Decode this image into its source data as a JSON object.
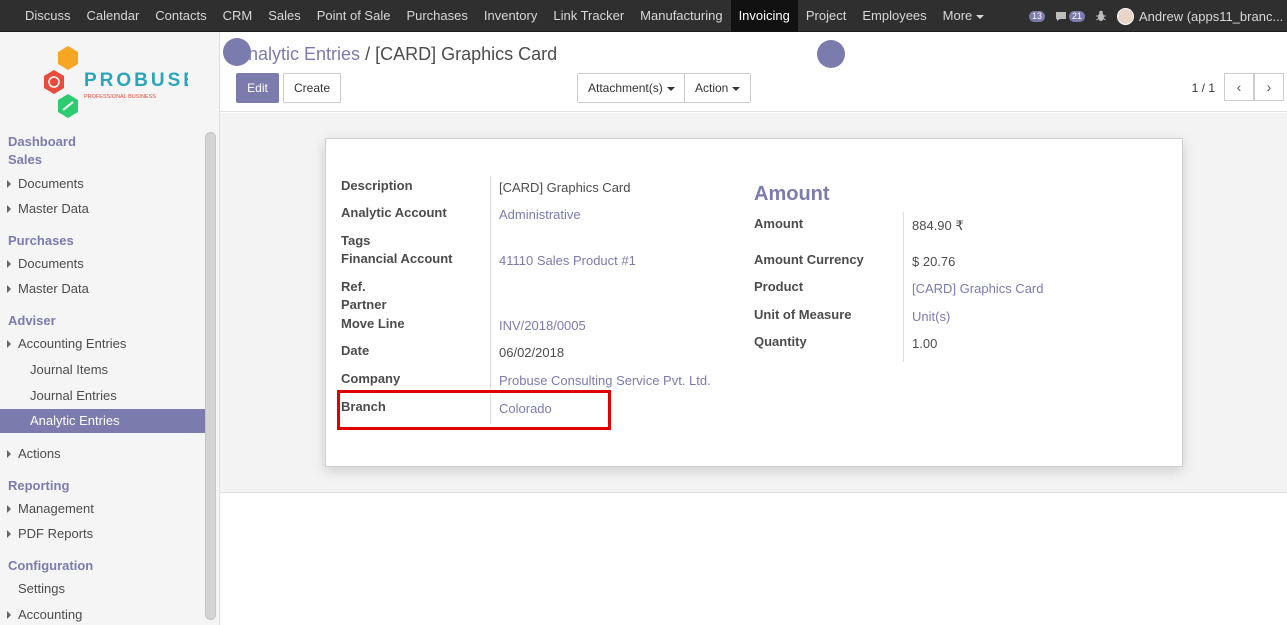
{
  "topbar": {
    "menu": [
      "Discuss",
      "Calendar",
      "Contacts",
      "CRM",
      "Sales",
      "Point of Sale",
      "Purchases",
      "Inventory",
      "Link Tracker",
      "Manufacturing",
      "Invoicing",
      "Project",
      "Employees",
      "More"
    ],
    "active": "Invoicing",
    "messages_count": "13",
    "chat_count": "21",
    "user": "Andrew (apps11_branc..."
  },
  "logo": {
    "name": "PROBUSE",
    "tagline": "PROFESSIONAL BUSINESS"
  },
  "sidebar": {
    "dashboard": "Dashboard",
    "sales": "Sales",
    "sales_documents": "Documents",
    "sales_master": "Master Data",
    "purchases": "Purchases",
    "purchases_documents": "Documents",
    "purchases_master": "Master Data",
    "adviser": "Adviser",
    "accounting_entries": "Accounting Entries",
    "journal_items": "Journal Items",
    "journal_entries": "Journal Entries",
    "analytic_entries": "Analytic Entries",
    "actions": "Actions",
    "reporting": "Reporting",
    "management": "Management",
    "pdf_reports": "PDF Reports",
    "configuration": "Configuration",
    "settings": "Settings",
    "accounting": "Accounting"
  },
  "control_panel": {
    "breadcrumb_parent": "Analytic Entries",
    "breadcrumb_sep": "/",
    "breadcrumb_current": "[CARD] Graphics Card",
    "edit": "Edit",
    "create": "Create",
    "attachments": "Attachment(s)",
    "action": "Action",
    "pager": "1 / 1"
  },
  "form": {
    "left": {
      "description_label": "Description",
      "description_value": "[CARD] Graphics Card",
      "analytic_account_label": "Analytic Account",
      "analytic_account_value": "Administrative",
      "tags_label": "Tags",
      "financial_account_label": "Financial Account",
      "financial_account_value": "41110 Sales Product #1",
      "ref_label": "Ref.",
      "partner_label": "Partner",
      "move_line_label": "Move Line",
      "move_line_value": "INV/2018/0005",
      "date_label": "Date",
      "date_value": "06/02/2018",
      "company_label": "Company",
      "company_value": "Probuse Consulting Service Pvt. Ltd.",
      "branch_label": "Branch",
      "branch_value": "Colorado"
    },
    "right": {
      "group_title": "Amount",
      "amount_label": "Amount",
      "amount_value": "884.90 ₹",
      "amount_currency_label": "Amount Currency",
      "amount_currency_value": "$ 20.76",
      "product_label": "Product",
      "product_value": "[CARD] Graphics Card",
      "uom_label": "Unit of Measure",
      "uom_value": "Unit(s)",
      "quantity_label": "Quantity",
      "quantity_value": "1.00"
    }
  },
  "colors": {
    "accent": "#7c7bad",
    "topbar": "#2f2f2f",
    "highlight": "#e00000"
  }
}
